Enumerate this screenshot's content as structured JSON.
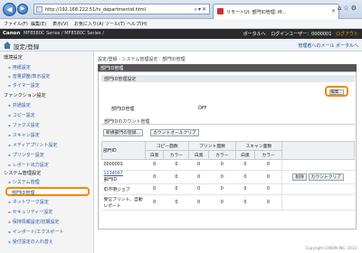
{
  "browser": {
    "url": "http://192.168.222.51/rs_departmentid.html",
    "tab_title": "リモートUI: 部門ID管理: M...",
    "menu": [
      "ファイル(F)",
      "編集(E)",
      "表示(V)",
      "お気に入り(A)",
      "ツール(T)",
      "ヘルプ(H)"
    ]
  },
  "app": {
    "brand": "Canon",
    "model": "MF8580C Series / MF8580C Series /",
    "header_right_prefix": "ポータルへ",
    "header_right_user": "ログインユーザー：0000001",
    "header_logout": "ログアウト",
    "mode_title": "設定/登録",
    "portal_link": "管理者へのメール ポータルへ"
  },
  "sidebar": {
    "sections": [
      {
        "label": "環境設定",
        "items": [
          "用紙設定",
          "音量調整/表示設定",
          "タイマー設定"
        ]
      },
      {
        "label": "ファンクション設定",
        "items": [
          "共通設定",
          "コピー設定",
          "ファクス設定",
          "スキャン設定",
          "メディアプリント設定",
          "プリンター設定",
          "レポート出力設定"
        ]
      },
      {
        "label": "システム管理設定",
        "items": [
          "システム管理",
          "部門ID管理",
          "ネットワーク設定",
          "セキュリティー設定",
          "保持情報設定/初期設定",
          "インポート/エクスポート",
          "受付設定の入れ替え"
        ]
      }
    ],
    "active": "部門ID管理"
  },
  "main": {
    "breadcrumb": "設定/登録 : システム管理設定 : 部門ID管理",
    "panel_title": "部門ID管理",
    "sub1_title": "部門ID管理設定",
    "edit_label": "編集...",
    "field_label": "部門ID管理",
    "field_value": "OFF",
    "sub2_title": "部門IDのカウント管理",
    "register_btn": "新規部門の登録...",
    "clear_all_btn": "カウントオールクリア",
    "col_id": "部門ID",
    "col_copy": "コピー面数",
    "col_print": "プリント面数",
    "col_scan": "スキャン面数",
    "sub_mono": "白黒",
    "sub_color": "カラー",
    "rows": [
      {
        "id": "0000001",
        "link": "",
        "vals": [
          "0",
          "0",
          "0",
          "0",
          "0",
          "0"
        ],
        "delete": "",
        "clear": ""
      },
      {
        "id": "1234567",
        "link": "部門ID",
        "vals": [
          "0",
          "0",
          "0",
          "0",
          "0",
          "0"
        ],
        "delete": "削除",
        "clear": "カウントクリア"
      },
      {
        "id": "ID不明ジョブ",
        "link": "",
        "vals": [
          "0",
          "0",
          "0",
          "0",
          "0",
          "0"
        ],
        "delete": "",
        "clear": ""
      },
      {
        "id": "受信プリント、自動レポート",
        "link": "",
        "vals": [
          "0",
          "0",
          "0",
          "0",
          "0",
          "0"
        ],
        "delete": "",
        "clear": ""
      }
    ]
  },
  "footer": "Copyright CANON INC. 2013"
}
